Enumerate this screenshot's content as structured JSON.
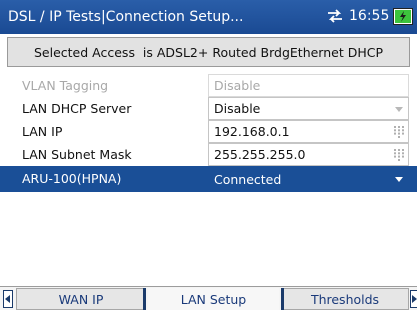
{
  "titlebar": {
    "title": "DSL / IP Tests|Connection Setup...",
    "time": "16:55",
    "network_icon": "network-transfer-icon",
    "battery_icon": "battery-icon"
  },
  "banner": {
    "text": "Selected Access  is ADSL2+ Routed BrdgEthernet DHCP"
  },
  "rows": [
    {
      "label": "VLAN Tagging",
      "value": "Disable",
      "control": "dropdown",
      "state": "disabled"
    },
    {
      "label": "LAN DHCP Server",
      "value": "Disable",
      "control": "dropdown",
      "state": "normal"
    },
    {
      "label": "LAN IP",
      "value": "192.168.0.1",
      "control": "keypad",
      "state": "normal"
    },
    {
      "label": "LAN Subnet Mask",
      "value": "255.255.255.0",
      "control": "keypad",
      "state": "normal"
    },
    {
      "label": "ARU-100(HPNA)",
      "value": "Connected",
      "control": "dropdown",
      "state": "selected"
    }
  ],
  "tabs": [
    {
      "label": "WAN IP",
      "active": false
    },
    {
      "label": "LAN Setup",
      "active": true
    },
    {
      "label": "Thresholds",
      "active": false
    }
  ],
  "colors": {
    "titlebar": "#1a4a93",
    "selected_row": "#1a4f97",
    "tab_text": "#1a3a7a"
  }
}
